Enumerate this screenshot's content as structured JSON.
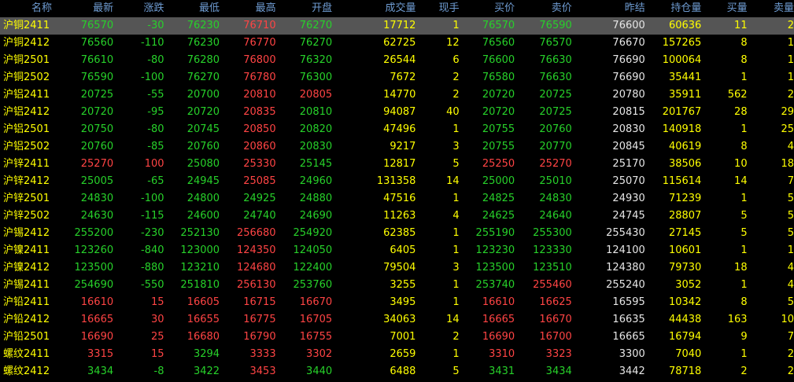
{
  "colors": {
    "up": "#ff4444",
    "down": "#27d12a",
    "flat": "#e6e6e6",
    "name": "#ffff00",
    "volume": "#ffff00",
    "header": "#6f9cd2"
  },
  "headers": [
    "名称",
    "最新",
    "涨跌",
    "最低",
    "最高",
    "开盘",
    "成交量",
    "现手",
    "买价",
    "卖价",
    "昨结",
    "持仓量",
    "买量",
    "卖量"
  ],
  "selected_row": 0,
  "rows": [
    [
      "沪铜2411",
      "76570",
      "-30",
      "76230",
      "76710",
      "76270",
      "17712",
      "1",
      "76570",
      "76590",
      "76600",
      "60636",
      "11",
      "2"
    ],
    [
      "沪铜2412",
      "76560",
      "-110",
      "76230",
      "76770",
      "76270",
      "62725",
      "12",
      "76560",
      "76570",
      "76670",
      "157265",
      "8",
      "1"
    ],
    [
      "沪铜2501",
      "76610",
      "-80",
      "76280",
      "76800",
      "76320",
      "26544",
      "6",
      "76600",
      "76630",
      "76690",
      "100064",
      "8",
      "1"
    ],
    [
      "沪铜2502",
      "76590",
      "-100",
      "76270",
      "76780",
      "76300",
      "7672",
      "2",
      "76580",
      "76630",
      "76690",
      "35441",
      "1",
      "1"
    ],
    [
      "沪铝2411",
      "20725",
      "-55",
      "20700",
      "20810",
      "20805",
      "14770",
      "2",
      "20720",
      "20725",
      "20780",
      "35911",
      "562",
      "2"
    ],
    [
      "沪铝2412",
      "20720",
      "-95",
      "20720",
      "20835",
      "20810",
      "94087",
      "40",
      "20720",
      "20725",
      "20815",
      "201767",
      "28",
      "29"
    ],
    [
      "沪铝2501",
      "20750",
      "-80",
      "20745",
      "20850",
      "20820",
      "47496",
      "1",
      "20755",
      "20760",
      "20830",
      "140918",
      "1",
      "25"
    ],
    [
      "沪铝2502",
      "20760",
      "-85",
      "20760",
      "20860",
      "20830",
      "9217",
      "3",
      "20755",
      "20770",
      "20845",
      "40619",
      "8",
      "4"
    ],
    [
      "沪锌2411",
      "25270",
      "100",
      "25080",
      "25330",
      "25145",
      "12817",
      "5",
      "25250",
      "25270",
      "25170",
      "38506",
      "10",
      "18"
    ],
    [
      "沪锌2412",
      "25005",
      "-65",
      "24945",
      "25085",
      "24960",
      "131358",
      "14",
      "25000",
      "25010",
      "25070",
      "115614",
      "14",
      "7"
    ],
    [
      "沪锌2501",
      "24830",
      "-100",
      "24800",
      "24925",
      "24880",
      "47516",
      "1",
      "24825",
      "24830",
      "24930",
      "71239",
      "1",
      "5"
    ],
    [
      "沪锌2502",
      "24630",
      "-115",
      "24600",
      "24740",
      "24690",
      "11263",
      "4",
      "24625",
      "24640",
      "24745",
      "28807",
      "5",
      "5"
    ],
    [
      "沪锡2412",
      "255200",
      "-230",
      "252130",
      "256680",
      "254920",
      "62385",
      "1",
      "255190",
      "255300",
      "255430",
      "27145",
      "5",
      "5"
    ],
    [
      "沪镍2411",
      "123260",
      "-840",
      "123000",
      "124350",
      "124050",
      "6405",
      "1",
      "123230",
      "123330",
      "124100",
      "10601",
      "1",
      "1"
    ],
    [
      "沪镍2412",
      "123500",
      "-880",
      "123210",
      "124680",
      "122400",
      "79504",
      "3",
      "123500",
      "123510",
      "124380",
      "79730",
      "18",
      "4"
    ],
    [
      "沪锡2411",
      "254690",
      "-550",
      "251810",
      "256130",
      "253760",
      "3255",
      "1",
      "253740",
      "255460",
      "255240",
      "3052",
      "1",
      "4"
    ],
    [
      "沪铅2411",
      "16610",
      "15",
      "16605",
      "16715",
      "16670",
      "3495",
      "1",
      "16610",
      "16625",
      "16595",
      "10342",
      "8",
      "5"
    ],
    [
      "沪铅2412",
      "16665",
      "30",
      "16655",
      "16775",
      "16705",
      "34063",
      "14",
      "16665",
      "16670",
      "16635",
      "44438",
      "163",
      "10"
    ],
    [
      "沪铅2501",
      "16690",
      "25",
      "16680",
      "16790",
      "16755",
      "7001",
      "2",
      "16690",
      "16700",
      "16665",
      "16794",
      "9",
      "7"
    ],
    [
      "螺纹2411",
      "3315",
      "15",
      "3294",
      "3333",
      "3302",
      "2659",
      "1",
      "3310",
      "3323",
      "3300",
      "7040",
      "1",
      "2"
    ],
    [
      "螺纹2412",
      "3434",
      "-8",
      "3422",
      "3453",
      "3440",
      "6488",
      "5",
      "3431",
      "3434",
      "3442",
      "78718",
      "2",
      "2"
    ]
  ]
}
